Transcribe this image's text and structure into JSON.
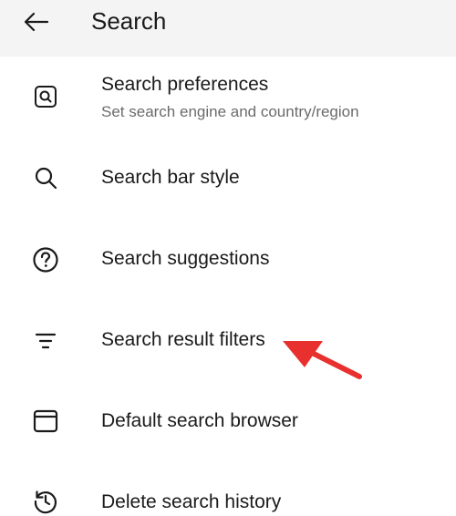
{
  "header": {
    "title": "Search"
  },
  "items": [
    {
      "label": "Search preferences",
      "subtitle": "Set search engine and country/region",
      "icon": "search-box-icon"
    },
    {
      "label": "Search bar style",
      "icon": "magnifier-icon"
    },
    {
      "label": "Search suggestions",
      "icon": "help-circle-icon"
    },
    {
      "label": "Search result filters",
      "icon": "filter-lines-icon"
    },
    {
      "label": "Default search browser",
      "icon": "browser-window-icon"
    },
    {
      "label": "Delete search history",
      "icon": "history-icon"
    }
  ],
  "annotation": {
    "type": "red-arrow",
    "points_to": "Search result filters",
    "color": "#e8312f"
  },
  "colors": {
    "header_bg": "#f4f4f4",
    "text_primary": "#1a1a1a",
    "text_secondary": "#6b6b6b"
  }
}
